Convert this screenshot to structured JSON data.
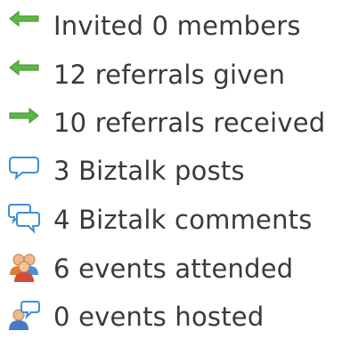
{
  "stats": {
    "items": [
      {
        "icon": "arrow-left-green-icon",
        "label": "Invited 0 members"
      },
      {
        "icon": "arrow-left-green-icon",
        "label": "12 referrals given"
      },
      {
        "icon": "arrow-right-green-icon",
        "label": "10 referrals received"
      },
      {
        "icon": "speech-bubble-icon",
        "label": "3 Biztalk posts"
      },
      {
        "icon": "double-speech-bubble-icon",
        "label": "4 Biztalk comments"
      },
      {
        "icon": "people-group-icon",
        "label": "6 events attended"
      },
      {
        "icon": "person-with-bubble-icon",
        "label": "0 events hosted"
      }
    ]
  },
  "colors": {
    "arrow_green": "#4fae3a",
    "bubble_blue": "#3f8fd6",
    "text": "#3a3a3a"
  }
}
